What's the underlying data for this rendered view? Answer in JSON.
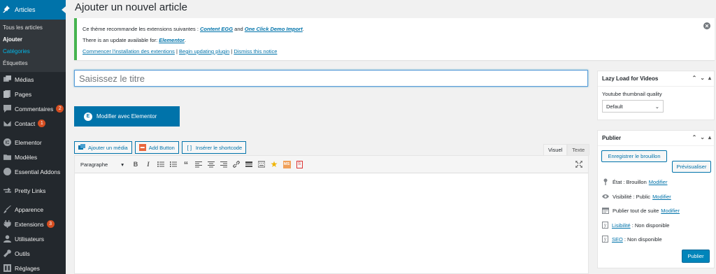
{
  "sidebar": {
    "active": "Articles",
    "submenu": [
      "Tous les articles",
      "Ajouter",
      "Catégories",
      "Étiquettes"
    ],
    "items": [
      {
        "label": "Médias",
        "icon": "media-icon"
      },
      {
        "label": "Pages",
        "icon": "pages-icon"
      },
      {
        "label": "Commentaires",
        "icon": "comments-icon",
        "badge": "2"
      },
      {
        "label": "Contact",
        "icon": "mail-icon",
        "badge": "1"
      },
      {
        "label": "Elementor",
        "icon": "elementor-icon"
      },
      {
        "label": "Modèles",
        "icon": "folder-icon"
      },
      {
        "label": "Essential Addons",
        "icon": "ea-icon"
      },
      {
        "label": "Pretty Links",
        "icon": "link-icon"
      },
      {
        "label": "Apparence",
        "icon": "brush-icon"
      },
      {
        "label": "Extensions",
        "icon": "plugin-icon",
        "badge": "3"
      },
      {
        "label": "Utilisateurs",
        "icon": "users-icon"
      },
      {
        "label": "Outils",
        "icon": "wrench-icon"
      },
      {
        "label": "Réglages",
        "icon": "settings-icon"
      }
    ]
  },
  "page": {
    "title": "Ajouter un nouvel article"
  },
  "notice": {
    "line1_text": "Ce thème recommande les extensions suivantes : ",
    "line1_link1": "Content EGG",
    "line1_and": " and ",
    "line1_link2": "One Click Demo Import",
    "line1_end": ".",
    "line2_text": "There is an update available for: ",
    "line2_link": "Elementor",
    "line2_end": ".",
    "link_install": "Commencer l'installation des extentions",
    "sep": " | ",
    "link_update": "Begin updating plugin",
    "link_dismiss": "Dismiss this notice"
  },
  "editor": {
    "title_placeholder": "Saisissez le titre",
    "elementor_button": "Modifier avec Elementor",
    "elementor_badge": "E",
    "media_buttons": {
      "add_media": "Ajouter un média",
      "add_button": "Add Button",
      "insert_shortcode": "Insérer le shortcode"
    },
    "tabs": {
      "visual": "Visuel",
      "text": "Texte"
    },
    "format_select": "Paragraphe",
    "bold": "B",
    "italic": "I",
    "quote": "“",
    "star": "★",
    "ms_icon_text": "MS",
    "s_icon_text": "S"
  },
  "lazy_load": {
    "title": "Lazy Load for Videos",
    "label": "Youtube thumbnail quality",
    "select_value": "Default"
  },
  "publish": {
    "title": "Publier",
    "save_draft": "Enregistrer le brouillon",
    "preview": "Prévisualiser",
    "status_label": "État : Brouillon",
    "status_link": "Modifier",
    "visibility_label": "Visibilité : Public",
    "visibility_link": "Modifier",
    "schedule_label": "Publier tout de suite",
    "schedule_link": "Modifier",
    "readability_link": "Lisibilité",
    "readability_value": " : Non disponible",
    "seo_link": "SEO",
    "seo_value": " : Non disponible",
    "publish_button": "Publier"
  },
  "colors": {
    "admin_blue": "#0073aa",
    "sidebar_bg": "#23282d",
    "notice_green": "#46b450",
    "badge": "#d54e21"
  }
}
